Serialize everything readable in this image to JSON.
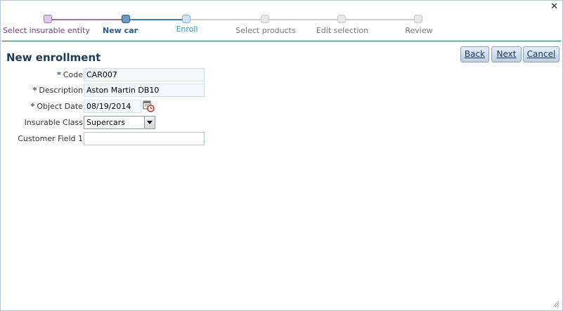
{
  "dialog": {
    "close_icon": "close-icon"
  },
  "train": {
    "stops": [
      {
        "label": "Select insurable entity",
        "state": "visited"
      },
      {
        "label": "New car",
        "state": "current"
      },
      {
        "label": "Enroll",
        "state": "next"
      },
      {
        "label": "Select products",
        "state": "disabled"
      },
      {
        "label": "Edit selection",
        "state": "disabled"
      },
      {
        "label": "Review",
        "state": "disabled"
      }
    ]
  },
  "page": {
    "title": "New enrollment"
  },
  "buttons": {
    "back": "Back",
    "next": "Next",
    "cancel": "Cancel"
  },
  "form": {
    "required_marker": "*",
    "code": {
      "label": "Code",
      "value": "CAR007"
    },
    "description": {
      "label": "Description",
      "value": "Aston Martin DB10"
    },
    "object_date": {
      "label": "Object Date",
      "value": "08/19/2014",
      "icon": "calendar-clock-icon"
    },
    "insurable_class": {
      "label": "Insurable Class",
      "value": "Supercars"
    },
    "customer_field_1": {
      "label": "Customer Field 1",
      "value": ""
    }
  },
  "colors": {
    "accent": "#1c3d5a",
    "visited": "#7a3d8c",
    "next": "#2b97c8"
  }
}
